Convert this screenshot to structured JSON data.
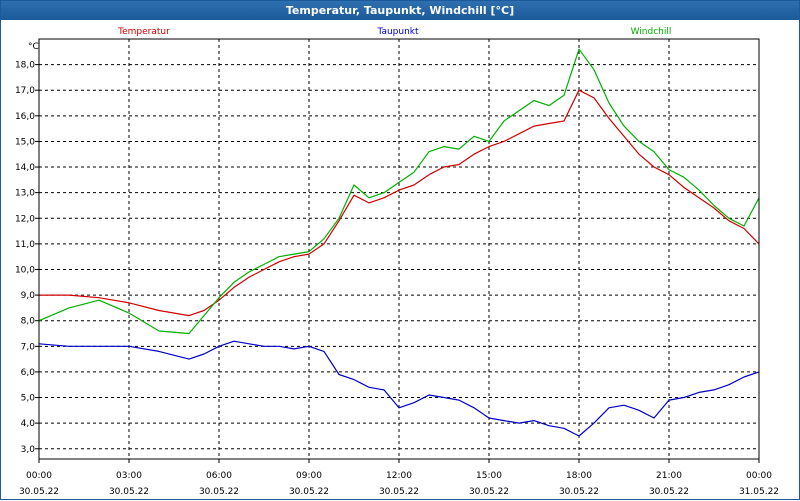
{
  "window": {
    "title": "Temperatur, Taupunkt, Windchill [°C]"
  },
  "chart_data": {
    "type": "line",
    "title": "Temperatur, Taupunkt, Windchill [°C]",
    "ylabel": "°C",
    "ylim": [
      2.6,
      19.0
    ],
    "yticks": [
      "3,0",
      "4,0",
      "5,0",
      "6,0",
      "7,0",
      "8,0",
      "9,0",
      "10,0",
      "11,0",
      "12,0",
      "13,0",
      "14,0",
      "15,0",
      "16,0",
      "17,0",
      "18,0"
    ],
    "xlim": [
      0,
      24
    ],
    "xticks": [
      {
        "time": "00:00",
        "date": "30.05.22"
      },
      {
        "time": "03:00",
        "date": "30.05.22"
      },
      {
        "time": "06:00",
        "date": "30.05.22"
      },
      {
        "time": "09:00",
        "date": "30.05.22"
      },
      {
        "time": "12:00",
        "date": "30.05.22"
      },
      {
        "time": "15:00",
        "date": "30.05.22"
      },
      {
        "time": "18:00",
        "date": "30.05.22"
      },
      {
        "time": "21:00",
        "date": "30.05.22"
      },
      {
        "time": "00:00",
        "date": "31.05.22"
      }
    ],
    "grid": true,
    "legend_placement": "top",
    "series": [
      {
        "name": "Temperatur",
        "color": "#d00000",
        "x": [
          0,
          1,
          2,
          3,
          4,
          5,
          5.5,
          6,
          6.5,
          7,
          7.5,
          8,
          8.5,
          9,
          9.5,
          10,
          10.5,
          11,
          11.5,
          12,
          12.5,
          13,
          13.5,
          14,
          14.5,
          15,
          15.5,
          16,
          16.5,
          17,
          17.5,
          18,
          18.5,
          19,
          19.5,
          20,
          20.5,
          21,
          21.5,
          22,
          22.5,
          23,
          23.5,
          24
        ],
        "values": [
          9.0,
          9.0,
          8.9,
          8.7,
          8.4,
          8.2,
          8.4,
          8.8,
          9.3,
          9.7,
          10.0,
          10.3,
          10.5,
          10.6,
          11.0,
          11.9,
          12.9,
          12.6,
          12.8,
          13.1,
          13.3,
          13.7,
          14.0,
          14.1,
          14.5,
          14.8,
          15.0,
          15.3,
          15.6,
          15.7,
          15.8,
          17.0,
          16.7,
          15.9,
          15.2,
          14.5,
          14.0,
          13.7,
          13.2,
          12.8,
          12.4,
          11.9,
          11.6,
          11.0
        ]
      },
      {
        "name": "Taupunkt",
        "color": "#0000c8",
        "x": [
          0,
          1,
          2,
          3,
          4,
          5,
          5.5,
          6,
          6.5,
          7,
          7.5,
          8,
          8.5,
          9,
          9.5,
          10,
          10.5,
          11,
          11.5,
          12,
          12.5,
          13,
          13.5,
          14,
          14.5,
          15,
          15.5,
          16,
          16.5,
          17,
          17.5,
          18,
          18.5,
          19,
          19.5,
          20,
          20.5,
          21,
          21.5,
          22,
          22.5,
          23,
          23.5,
          24
        ],
        "values": [
          7.1,
          7.0,
          7.0,
          7.0,
          6.8,
          6.5,
          6.7,
          7.0,
          7.2,
          7.1,
          7.0,
          7.0,
          6.9,
          7.0,
          6.8,
          5.9,
          5.7,
          5.4,
          5.3,
          4.6,
          4.8,
          5.1,
          5.0,
          4.9,
          4.6,
          4.2,
          4.1,
          4.0,
          4.1,
          3.9,
          3.8,
          3.5,
          4.0,
          4.6,
          4.7,
          4.5,
          4.2,
          4.9,
          5.0,
          5.2,
          5.3,
          5.5,
          5.8,
          6.0
        ]
      },
      {
        "name": "Windchill",
        "color": "#00b000",
        "x": [
          0,
          1,
          2,
          3,
          4,
          5,
          5.5,
          6,
          6.5,
          7,
          7.5,
          8,
          8.5,
          9,
          9.5,
          10,
          10.5,
          11,
          11.5,
          12,
          12.5,
          13,
          13.5,
          14,
          14.5,
          15,
          15.5,
          16,
          16.5,
          17,
          17.5,
          18,
          18.5,
          19,
          19.5,
          20,
          20.5,
          21,
          21.5,
          22,
          22.5,
          23,
          23.5,
          24
        ],
        "values": [
          8.0,
          8.5,
          8.8,
          8.3,
          7.6,
          7.5,
          8.2,
          8.9,
          9.5,
          9.9,
          10.2,
          10.5,
          10.6,
          10.7,
          11.2,
          12.0,
          13.3,
          12.8,
          13.0,
          13.4,
          13.8,
          14.6,
          14.8,
          14.7,
          15.2,
          15.0,
          15.8,
          16.2,
          16.6,
          16.4,
          16.8,
          18.6,
          17.8,
          16.5,
          15.6,
          15.0,
          14.6,
          13.9,
          13.6,
          13.1,
          12.5,
          12.0,
          11.7,
          12.8
        ]
      }
    ]
  }
}
